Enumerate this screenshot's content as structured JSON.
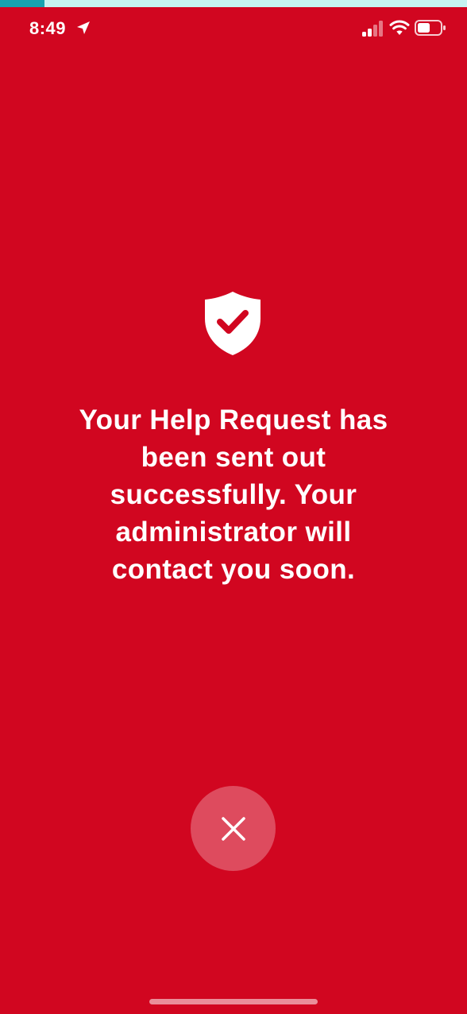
{
  "status_bar": {
    "time": "8:49",
    "icons": [
      "location-arrow-icon",
      "cellular-signal-icon",
      "wifi-icon",
      "battery-icon"
    ]
  },
  "screen": {
    "background_color": "#d10620",
    "icon": "shield-check-icon",
    "message": "Your Help Request has been sent out successfully. Your administrator will contact you soon."
  },
  "close_button": {
    "icon": "close-icon"
  }
}
